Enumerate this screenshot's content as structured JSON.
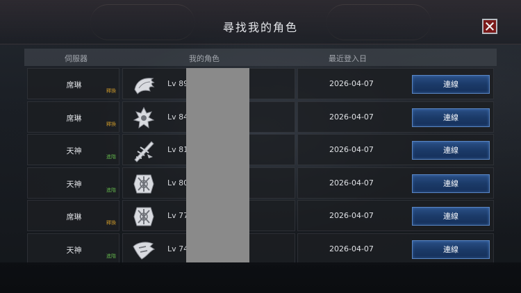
{
  "dialog": {
    "title": "尋找我的角色",
    "close_icon": "close-icon"
  },
  "columns": {
    "server": "伺服器",
    "character": "我的角色",
    "last_login": "最近登入日"
  },
  "colors": {
    "tag_gold": "#c8962a",
    "tag_green": "#5fae4a",
    "connect_button": "#1b3a68"
  },
  "rows": [
    {
      "server": "席琳",
      "tag": "釋換",
      "tag_color": "#c8962a",
      "class_icon": "wing-emblem-icon",
      "level": "Lv 89",
      "last_login": "2026-04-07",
      "connect": "連線"
    },
    {
      "server": "席琳",
      "tag": "釋換",
      "tag_color": "#c8962a",
      "class_icon": "crest-emblem-icon",
      "level": "Lv 84",
      "last_login": "2026-04-07",
      "connect": "連線"
    },
    {
      "server": "天神",
      "tag": "進階",
      "tag_color": "#5fae4a",
      "class_icon": "blade-emblem-icon",
      "level": "Lv 81",
      "last_login": "2026-04-07",
      "connect": "連線"
    },
    {
      "server": "天神",
      "tag": "進階",
      "tag_color": "#5fae4a",
      "class_icon": "rune-emblem-icon",
      "level": "Lv 80",
      "last_login": "2026-04-07",
      "connect": "連線"
    },
    {
      "server": "席琳",
      "tag": "釋換",
      "tag_color": "#c8962a",
      "class_icon": "rune-emblem-icon",
      "level": "Lv 77",
      "last_login": "2026-04-07",
      "connect": "連線"
    },
    {
      "server": "天神",
      "tag": "進階",
      "tag_color": "#5fae4a",
      "class_icon": "beast-emblem-icon",
      "level": "Lv 74",
      "last_login": "2026-04-07",
      "connect": "連線"
    }
  ]
}
